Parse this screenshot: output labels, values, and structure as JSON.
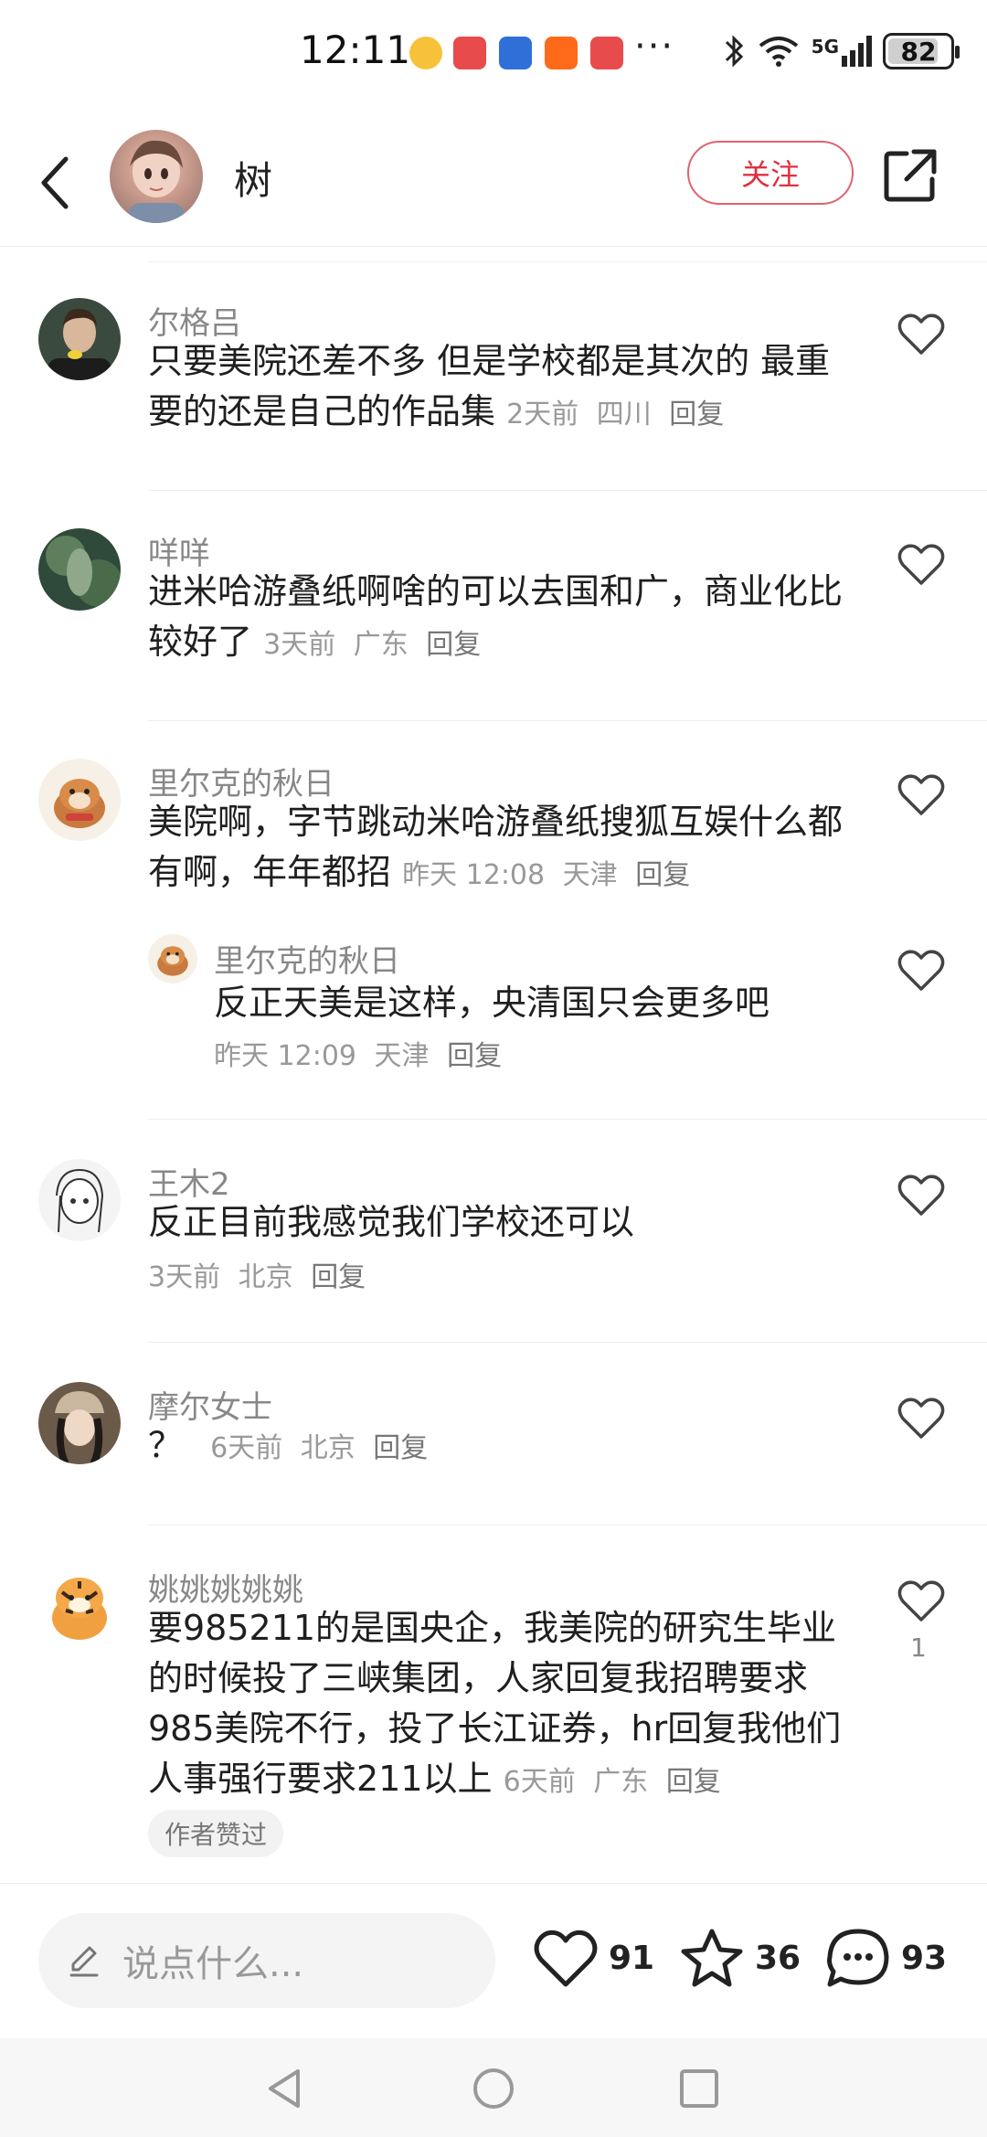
{
  "status_bar": {
    "time": "12:11",
    "dots": "···",
    "network": "5G",
    "battery": "82",
    "battery_level_percent": 82
  },
  "header": {
    "username": "树",
    "follow_label": "关注"
  },
  "comments": [
    {
      "username": "尔格吕",
      "text": "只要美院还差不多 但是学校都是其次的 最重要的还是自己的作品集",
      "time": "2天前",
      "location": "四川",
      "reply_label": "回复"
    },
    {
      "username": "咩咩",
      "text": "进米哈游叠纸啊啥的可以去国和广，商业化比较好了",
      "time": "3天前",
      "location": "广东",
      "reply_label": "回复"
    },
    {
      "username": "里尔克的秋日",
      "text": "美院啊，字节跳动米哈游叠纸搜狐互娱什么都有啊，年年都招",
      "time": "昨天 12:08",
      "location": "天津",
      "reply_label": "回复",
      "sub_reply": {
        "username": "里尔克的秋日",
        "text": "反正天美是这样，央清国只会更多吧",
        "time": "昨天 12:09",
        "location": "天津",
        "reply_label": "回复"
      }
    },
    {
      "username": "王木2",
      "text": "反正目前我感觉我们学校还可以",
      "time": "3天前",
      "location": "北京",
      "reply_label": "回复"
    },
    {
      "username": "摩尔女士",
      "text": "？",
      "time": "6天前",
      "location": "北京",
      "reply_label": "回复"
    },
    {
      "username": "姚姚姚姚姚",
      "text": "要985211的是国央企，我美院的研究生毕业的时候投了三峡集团，人家回复我招聘要求985美院不行，投了长江证券，hr回复我他们人事强行要求211以上",
      "time": "6天前",
      "location": "广东",
      "reply_label": "回复",
      "likes": "1",
      "badge": "作者赞过"
    }
  ],
  "bottom_bar": {
    "input_placeholder": "说点什么...",
    "likes": "91",
    "favorites": "36",
    "comments": "93"
  },
  "colors": {
    "accent": "#e0303f",
    "meta": "#999999"
  }
}
